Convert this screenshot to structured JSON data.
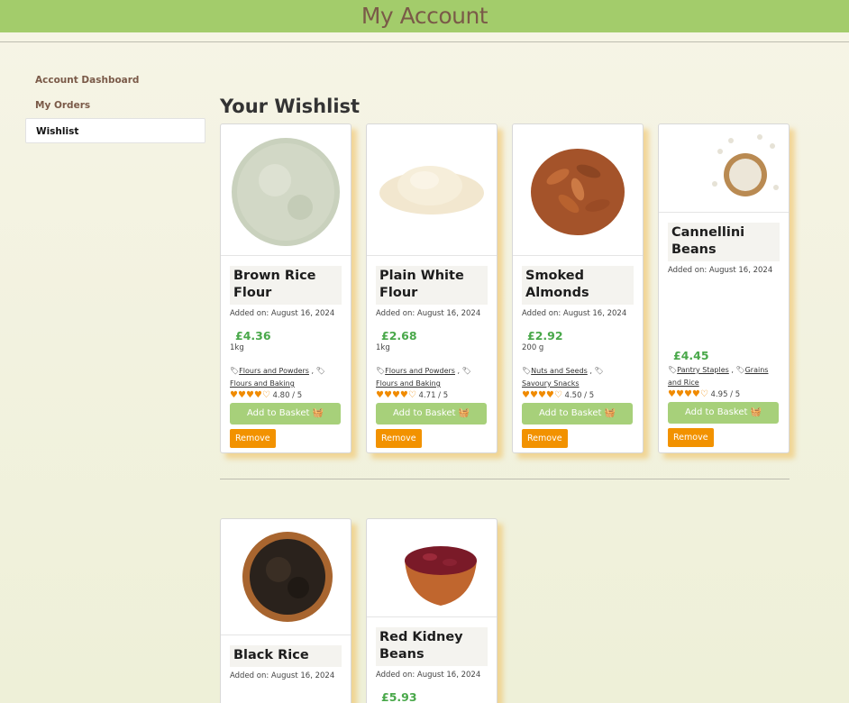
{
  "header": {
    "title": "My Account"
  },
  "sidebar": {
    "items": [
      {
        "label": "Account Dashboard"
      },
      {
        "label": "My Orders"
      },
      {
        "label": "Wishlist"
      }
    ]
  },
  "wishlist": {
    "title": "Your Wishlist",
    "basket_label": "Add to Basket",
    "remove_label": "Remove",
    "products": [
      {
        "name": "Brown Rice Flour",
        "added": "Added on: August 16, 2024",
        "price": "£4.36",
        "weight": "1kg",
        "tags": [
          "Flours and Powders",
          "Flours and Baking"
        ],
        "rating": "4.80 / 5",
        "stars": 4,
        "image": "flour-image"
      },
      {
        "name": "Plain White Flour",
        "added": "Added on: August 16, 2024",
        "price": "£2.68",
        "weight": "1kg",
        "tags": [
          "Flours and Powders",
          "Flours and Baking"
        ],
        "rating": "4.71 / 5",
        "stars": 4,
        "image": "flour-image"
      },
      {
        "name": "Smoked Almonds",
        "added": "Added on: August 16, 2024",
        "price": "£2.92",
        "weight": "200 g",
        "tags": [
          "Nuts and Seeds",
          "Savoury Snacks"
        ],
        "rating": "4.50 / 5",
        "stars": 4,
        "image": "almonds-image"
      },
      {
        "name": "Cannellini Beans",
        "added": "Added on: August 16, 2024",
        "price": "£4.45",
        "weight": "",
        "tags": [
          "Pantry Staples",
          "Grains and Rice"
        ],
        "rating": "4.95 / 5",
        "stars": 4,
        "image": "beans-image"
      },
      {
        "name": "Black Rice",
        "added": "Added on: August 16, 2024",
        "image": "black-rice-image"
      },
      {
        "name": "Red Kidney Beans",
        "added": "Added on: August 16, 2024",
        "price": "£5.93",
        "image": "kidney-beans-image"
      }
    ]
  }
}
